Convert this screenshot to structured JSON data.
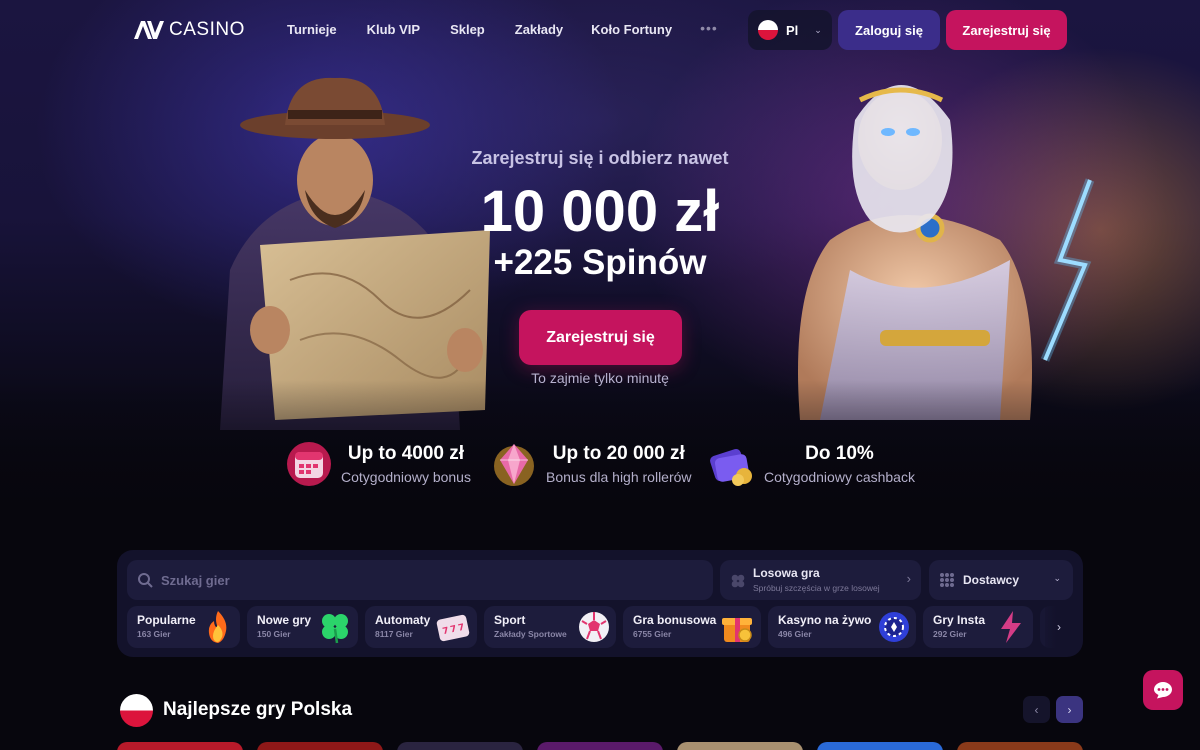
{
  "header": {
    "logo_text": "CASINO",
    "nav": [
      "Turnieje",
      "Klub VIP",
      "Sklep",
      "Zakłady",
      "Koło Fortuny"
    ],
    "nav_more": "•••",
    "language": "Pl",
    "login_label": "Zaloguj się",
    "register_label": "Zarejestruj się"
  },
  "hero": {
    "subtitle": "Zarejestruj się i odbierz nawet",
    "amount": "10 000 zł",
    "spins": "+225 Spinów",
    "cta_label": "Zarejestruj się",
    "note": "To zajmie tylko minutę"
  },
  "benefits": [
    {
      "title": "Up to 4000 zł",
      "desc": "Cotygodniowy bonus",
      "icon": "calendar-icon"
    },
    {
      "title": "Up to 20 000 zł",
      "desc": "Bonus dla high rollerów",
      "icon": "gem-icon"
    },
    {
      "title": "Do 10%",
      "desc": "Cotygodniowy cashback",
      "icon": "wallet-icon"
    }
  ],
  "games_panel": {
    "search_placeholder": "Szukaj gier",
    "random_title": "Losowa gra",
    "random_sub": "Spróbuj szczęścia w grze losowej",
    "providers_label": "Dostawcy",
    "categories": [
      {
        "name": "Popularne",
        "count": "163 Gier",
        "icon": "fire-icon"
      },
      {
        "name": "Nowe gry",
        "count": "150 Gier",
        "icon": "clover-icon"
      },
      {
        "name": "Automaty",
        "count": "8117 Gier",
        "icon": "slot-machine-icon"
      },
      {
        "name": "Sport",
        "count": "Zakłady Sportowe",
        "icon": "soccer-ball-icon"
      },
      {
        "name": "Gra bonusowa",
        "count": "6755 Gier",
        "icon": "gift-icon"
      },
      {
        "name": "Kasyno na żywo",
        "count": "496 Gier",
        "icon": "poker-chip-icon"
      },
      {
        "name": "Gry Insta",
        "count": "292 Gier",
        "icon": "lightning-icon"
      }
    ]
  },
  "section": {
    "title": "Najlepsze gry Polska"
  },
  "colors": {
    "accent_pink": "#c5145e",
    "accent_purple": "#3b2d8a",
    "panel_bg": "#13122b",
    "page_bg": "#07060d"
  }
}
